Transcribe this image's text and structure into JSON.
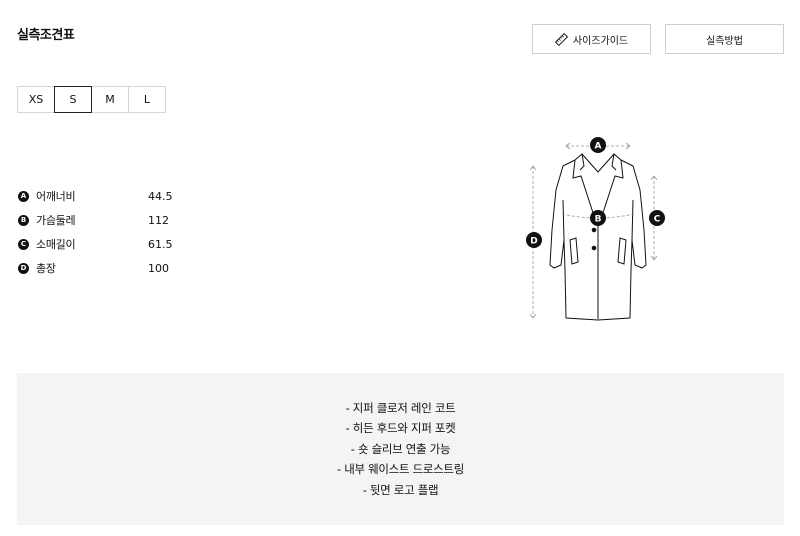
{
  "title": "실측조견표",
  "buttons": {
    "size_guide": "사이즈가이드",
    "measure_method": "실측방법"
  },
  "size_tabs": [
    {
      "label": "XS",
      "active": false
    },
    {
      "label": "S",
      "active": true
    },
    {
      "label": "M",
      "active": false
    },
    {
      "label": "L",
      "active": false
    }
  ],
  "measurements": [
    {
      "badge": "A",
      "label": "어깨너비",
      "value": "44.5"
    },
    {
      "badge": "B",
      "label": "가슴둘레",
      "value": "112"
    },
    {
      "badge": "C",
      "label": "소매길이",
      "value": "61.5"
    },
    {
      "badge": "D",
      "label": "총장",
      "value": "100"
    }
  ],
  "diagram_badges": {
    "a": "A",
    "b": "B",
    "c": "C",
    "d": "D"
  },
  "notes": [
    "- 지퍼 클로저 레인 코트",
    "- 히든 후드와 지퍼 포켓",
    "- 숏 슬리브 연출 가능",
    "- 내부 웨이스트 드로스트링",
    "- 뒷면 로고 플랩"
  ]
}
